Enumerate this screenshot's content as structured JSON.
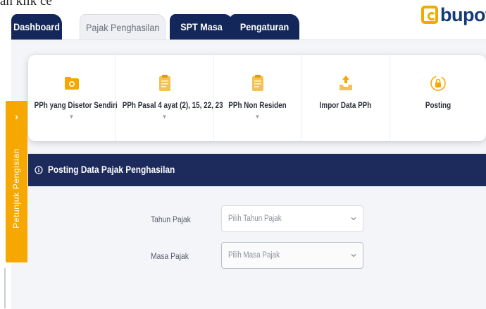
{
  "caption": "an klik ce",
  "logo": {
    "text": "bupot"
  },
  "tabs": [
    {
      "label": "Dashboard",
      "active": false
    },
    {
      "label": "Pajak Penghasilan",
      "active": true
    },
    {
      "label": "SPT Masa",
      "active": false
    },
    {
      "label": "Pengaturan",
      "active": false
    }
  ],
  "menu": [
    {
      "label": "PPh yang Disetor Sendiri",
      "icon": "folder-icon",
      "has_dropdown": true
    },
    {
      "label": "PPh Pasal 4 ayat (2), 15, 22, 23",
      "icon": "clipboard-icon",
      "has_dropdown": true
    },
    {
      "label": "PPh Non Residen",
      "icon": "clipboard-icon",
      "has_dropdown": true
    },
    {
      "label": "Impor Data PPh",
      "icon": "upload-tray-icon",
      "has_dropdown": false
    },
    {
      "label": "Posting",
      "icon": "lock-icon",
      "has_dropdown": false
    }
  ],
  "section": {
    "title": "Posting Data Pajak Penghasilan",
    "icon": "info-icon"
  },
  "form": {
    "tahun_label": "Tahun Pajak",
    "tahun_placeholder": "Pilih Tahun Pajak",
    "masa_label": "Masa Pajak",
    "masa_placeholder": "Pilih Masa Pajak"
  },
  "side_tab": {
    "arrow": "›",
    "label": "Petunjuk Pengisian"
  },
  "colors": {
    "navy": "#1c2a5c",
    "tab_dark": "#13275a",
    "accent_orange": "#f6a800",
    "logo_blue": "#143a78"
  }
}
